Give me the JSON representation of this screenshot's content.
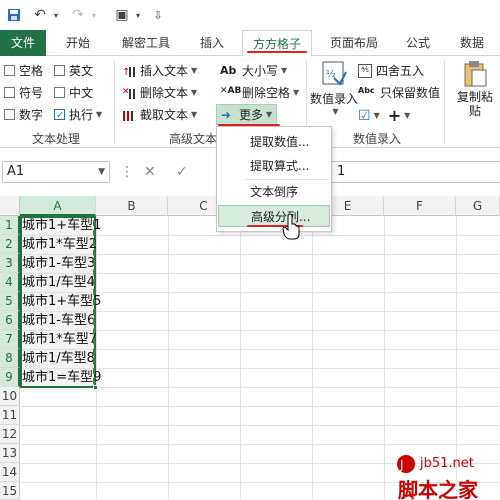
{
  "quick_access": {
    "icons": [
      "save-icon",
      "undo-icon",
      "redo-icon",
      "screenshot-icon",
      "customize-icon"
    ]
  },
  "tabs": [
    {
      "label": "文件"
    },
    {
      "label": "开始"
    },
    {
      "label": "解密工具"
    },
    {
      "label": "插入"
    },
    {
      "label": "方方格子"
    },
    {
      "label": "页面布局"
    },
    {
      "label": "公式"
    },
    {
      "label": "数据"
    }
  ],
  "ribbon": {
    "text_group": {
      "checkboxes": [
        "空格",
        "英文",
        "符号",
        "中文",
        "数字"
      ],
      "execute_label": "执行",
      "label": "文本处理"
    },
    "advanced_group": {
      "insert_text": "插入文本",
      "delete_text": "删除文本",
      "extract_text": "截取文本",
      "case": "大小写",
      "delete_space": "删除空格",
      "more": "更多",
      "label": "高级文本处理"
    },
    "number_group": {
      "number_input": "数值录入",
      "round": "四舍五入",
      "keep_value": "只保留数值",
      "label": "数值录入"
    },
    "paste_group": {
      "paste": "复制粘贴"
    }
  },
  "formula_bar": {
    "name_box": "A1",
    "content": "1"
  },
  "columns": [
    "A",
    "B",
    "C",
    "D",
    "E",
    "F",
    "G"
  ],
  "rows": [
    "1",
    "2",
    "3",
    "4",
    "5",
    "6",
    "7",
    "8",
    "9",
    "10",
    "11",
    "12",
    "13",
    "14",
    "15"
  ],
  "cells": [
    "城市1+车型1",
    "城市1*车型2",
    "城市1-车型3",
    "城市1/车型4",
    "城市1+车型5",
    "城市1-车型6",
    "城市1*车型7",
    "城市1/车型8",
    "城市1=车型9"
  ],
  "dropdown_menu": {
    "items": [
      "提取数值...",
      "提取算式...",
      "文本倒序",
      "高级分列..."
    ],
    "highlighted": "高级分列..."
  },
  "watermark": {
    "site": "jb51.net",
    "name": "脚本之家"
  },
  "colors": {
    "accent": "#217346",
    "highlight": "#d8ebdf",
    "annotation": "#dd2222"
  }
}
